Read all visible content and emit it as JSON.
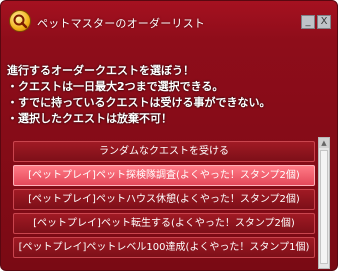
{
  "window": {
    "title": "ペットマスターのオーダーリスト",
    "minimize_label": "_",
    "close_label": "X",
    "logo_icon": "quest-magnifier-icon"
  },
  "instructions": [
    "進行するオーダークエストを選ぼう！",
    "・クエストは一日最大2つまで選択できる。",
    "・すでに持っているクエストは受ける事ができない。",
    "・選択したクエストは放棄不可！"
  ],
  "quests": [
    {
      "label": "ランダムなクエストを受ける",
      "selected": false
    },
    {
      "label": "[ペットプレイ]ペット探検隊調査(よくやった！スタンプ2個)",
      "selected": true
    },
    {
      "label": "[ペットプレイ]ペットハウス休憩(よくやった！スタンプ2個)",
      "selected": false
    },
    {
      "label": "[ペットプレイ]ペット転生する(よくやった！スタンプ2個)",
      "selected": false
    },
    {
      "label": "[ペットプレイ]ペットレベル100達成(よくやった！スタンプ1個)",
      "selected": false
    }
  ],
  "colors": {
    "panel": "#7a0a14",
    "selected_item": "#e4485a"
  }
}
